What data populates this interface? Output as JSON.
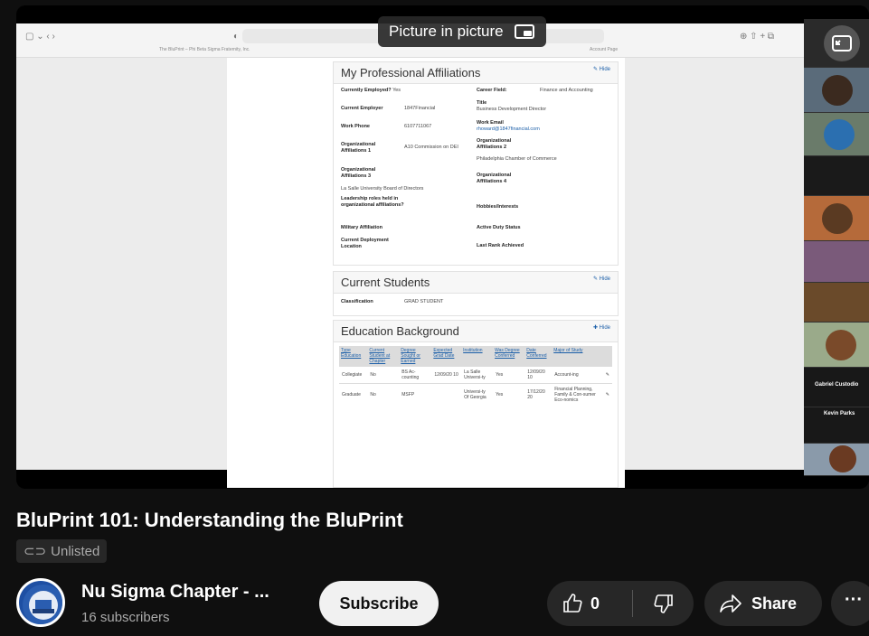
{
  "pip_label": "Picture in picture",
  "browser": {
    "tab_left": "The BluPrint – Phi Beta Sigma Fraternity, Inc.",
    "tab_right": "Account Page"
  },
  "affiliations": {
    "heading": "My Professional Affiliations",
    "hide": "Hide",
    "currently_employed_label": "Currently Employed?",
    "currently_employed_value": "Yes",
    "career_field_label": "Career Field:",
    "career_field_value": "Finance and Accounting",
    "current_employer_label": "Current Employer",
    "current_employer_value": "1847Financial",
    "title_label": "Title",
    "title_value": "Business Development Director",
    "work_phone_label": "Work Phone",
    "work_phone_value": "6107711067",
    "work_email_label": "Work Email",
    "work_email_value": "rhoward@1847financial.com",
    "org1_label": "Organizational Affiliations 1",
    "org1_value": "A10 Commission on DEI",
    "org2_label": "Organizational Affiliations 2",
    "org2_value": "Philadelphia Chamber of Commerce",
    "org3_label": "Organizational Affiliations 3",
    "org3_value": "La Salle University Board of Directors",
    "org4_label": "Organizational Affiliations 4",
    "leadership_label": "Leadership roles held in organizational affiliations?",
    "hobbies_label": "Hobbies/Interests",
    "military_label": "Military Affiliation",
    "active_duty_label": "Active Duty Status",
    "deployment_label": "Current Deployment Location",
    "last_rank_label": "Last Rank Achieved"
  },
  "students": {
    "heading": "Current Students",
    "hide": "Hide",
    "classification_label": "Classification",
    "classification_value": "GRAD STUDENT"
  },
  "education": {
    "heading": "Education Background",
    "hide": "Hide",
    "headers": [
      "Type Education",
      "Current Student at Chapter",
      "Degree Sought or Earned",
      "Expected Grad Date",
      "Institution",
      "Was Degree Conferred",
      "Date Conferred",
      "Major of Study"
    ],
    "rows": [
      [
        "Collegiate",
        "No",
        "BS Ac-counting",
        "12/09/20 10",
        "La Salle Universi-ty",
        "Yes",
        "12/09/20 10",
        "Account-ing"
      ],
      [
        "Graduate",
        "No",
        "MSFP",
        "",
        "Universi-ty Of Georgia",
        "Yes",
        "17/12/20 20",
        "Financial Planning, Family & Con-sumer Eco-nomics"
      ]
    ]
  },
  "participants": {
    "gabriel": "Gabriel Custodio",
    "kevin": "Kevin Parks"
  },
  "video": {
    "title": "BluPrint 101: Understanding the BluPrint",
    "visibility": "Unlisted"
  },
  "channel": {
    "name": "Nu Sigma Chapter - ...",
    "subscribers": "16 subscribers",
    "subscribe_label": "Subscribe"
  },
  "actions": {
    "like_count": "0",
    "share_label": "Share",
    "more_label": "···"
  }
}
